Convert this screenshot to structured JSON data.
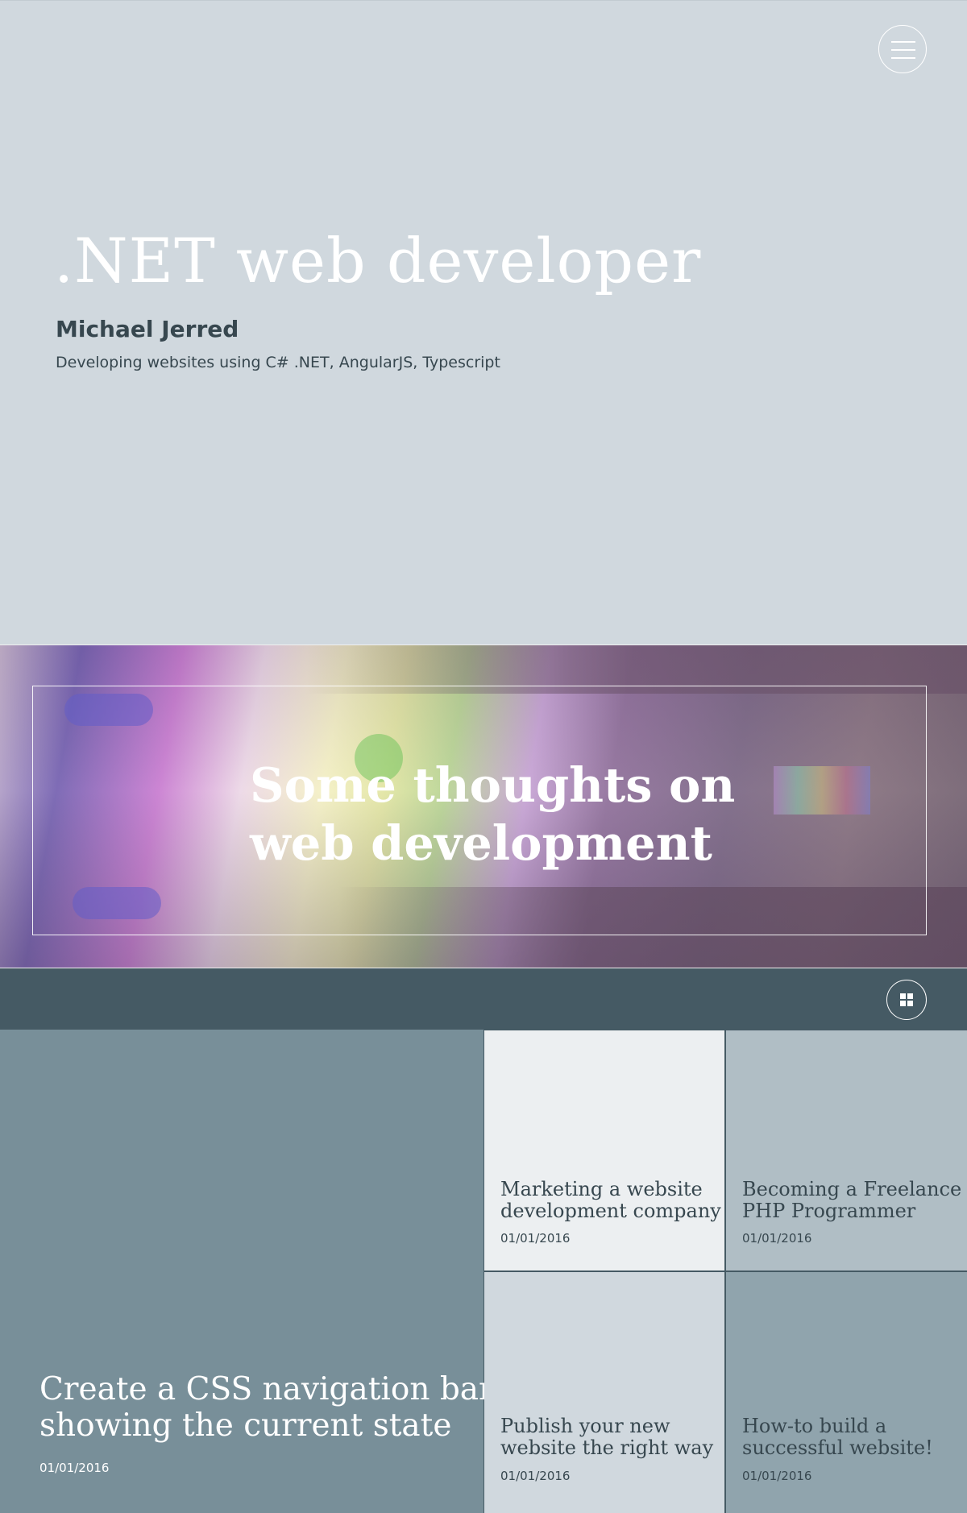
{
  "hero": {
    "title": ".NET web developer",
    "name": "Michael Jerred",
    "subtitle": "Developing websites using C# .NET, AngularJS, Typescript",
    "menu_icon": "hamburger-menu-icon"
  },
  "banner": {
    "title_line1": "Some thoughts on",
    "title_line2": "web development"
  },
  "toolbar": {
    "grid_icon": "grid-view-icon"
  },
  "posts": [
    {
      "title_line1": "Create a CSS navigation bar",
      "title_line2": "showing the current state",
      "date": "01/01/2016",
      "background": "#788f99"
    },
    {
      "title_line1": "Marketing a website",
      "title_line2": "development company",
      "date": "01/01/2016",
      "background": "#eceff1"
    },
    {
      "title_line1": "Becoming a Freelance",
      "title_line2": "PHP Programmer",
      "date": "01/01/2016",
      "background": "#b0bec5"
    },
    {
      "title_line1": "Publish your new",
      "title_line2": "website the right way",
      "date": "01/01/2016",
      "background": "#d0d8de"
    },
    {
      "title_line1": "How-to build a",
      "title_line2": "successful website!",
      "date": "01/01/2016",
      "background": "#90a4ad"
    }
  ],
  "colors": {
    "hero_background": "#d0d8de",
    "dark_slate": "#455a64",
    "text_dark": "#37474f",
    "text_light": "#ffffff"
  }
}
